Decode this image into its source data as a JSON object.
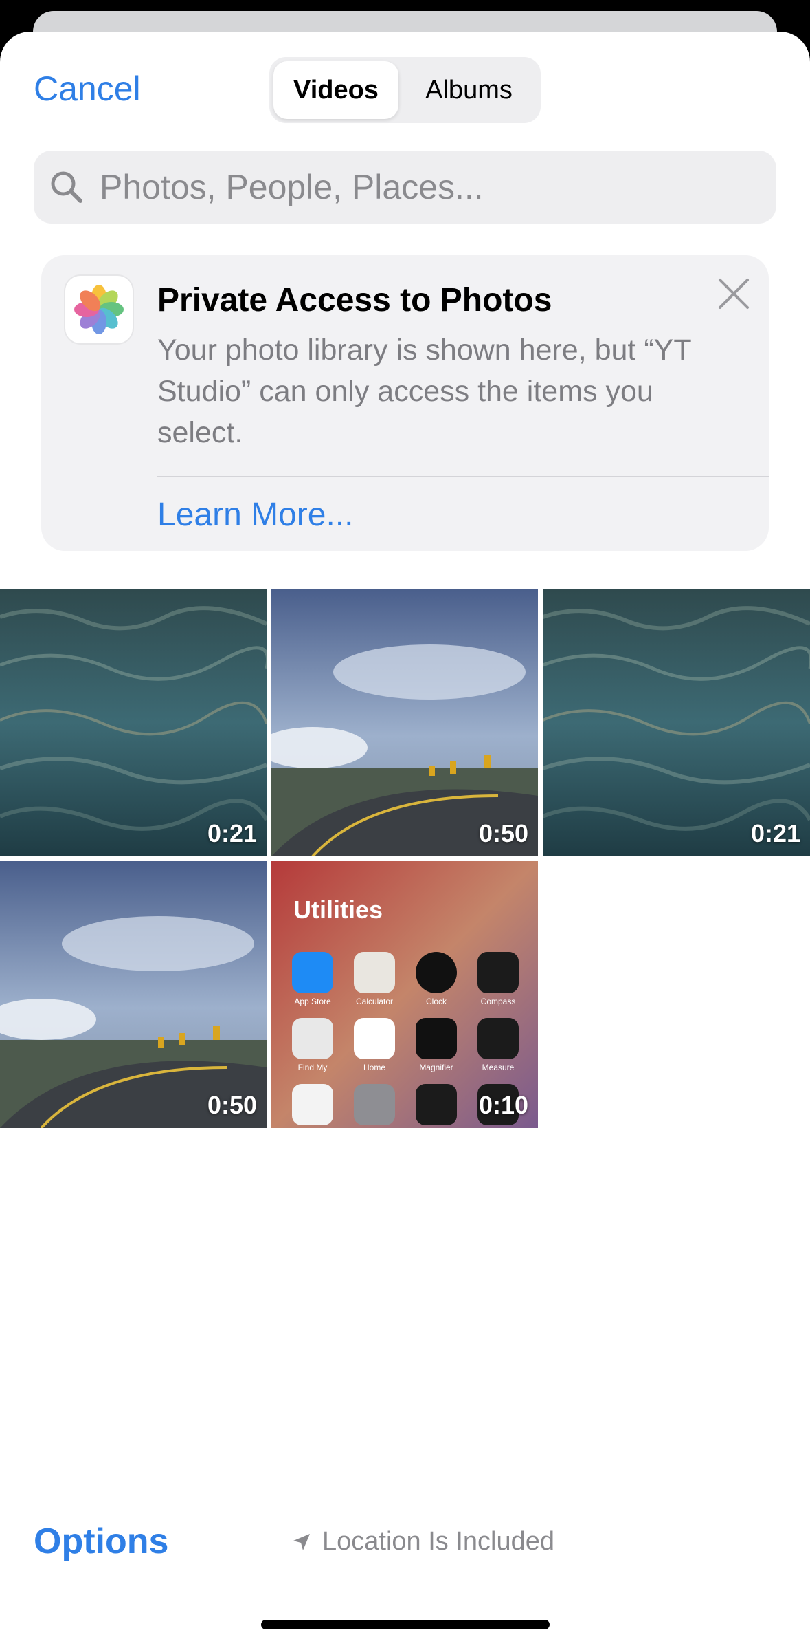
{
  "header": {
    "cancel_label": "Cancel",
    "tabs": [
      {
        "label": "Videos",
        "selected": true
      },
      {
        "label": "Albums",
        "selected": false
      }
    ]
  },
  "search": {
    "placeholder": "Photos, People, Places..."
  },
  "banner": {
    "title": "Private Access to Photos",
    "body": "Your photo library is shown here, but “YT Studio” can only access the items you select.",
    "link": "Learn More...",
    "icon": "photos-app-icon"
  },
  "grid": {
    "items": [
      {
        "type": "video",
        "scene": "ocean-waves",
        "duration": "0:21"
      },
      {
        "type": "video",
        "scene": "cloudy-road",
        "duration": "0:50"
      },
      {
        "type": "video",
        "scene": "ocean-waves",
        "duration": "0:21"
      },
      {
        "type": "video",
        "scene": "cloudy-road",
        "duration": "0:50"
      },
      {
        "type": "video",
        "scene": "utilities-folder",
        "duration": "0:10"
      }
    ],
    "utilities": {
      "title": "Utilities",
      "apps": [
        "App Store",
        "Calculator",
        "Clock",
        "Compass",
        "Find My",
        "Home",
        "Magnifier",
        "Measure"
      ]
    }
  },
  "footer": {
    "options_label": "Options",
    "location_label": "Location Is Included"
  },
  "colors": {
    "accent": "#2f7fe6",
    "secondary_text": "#8a8a8e"
  }
}
